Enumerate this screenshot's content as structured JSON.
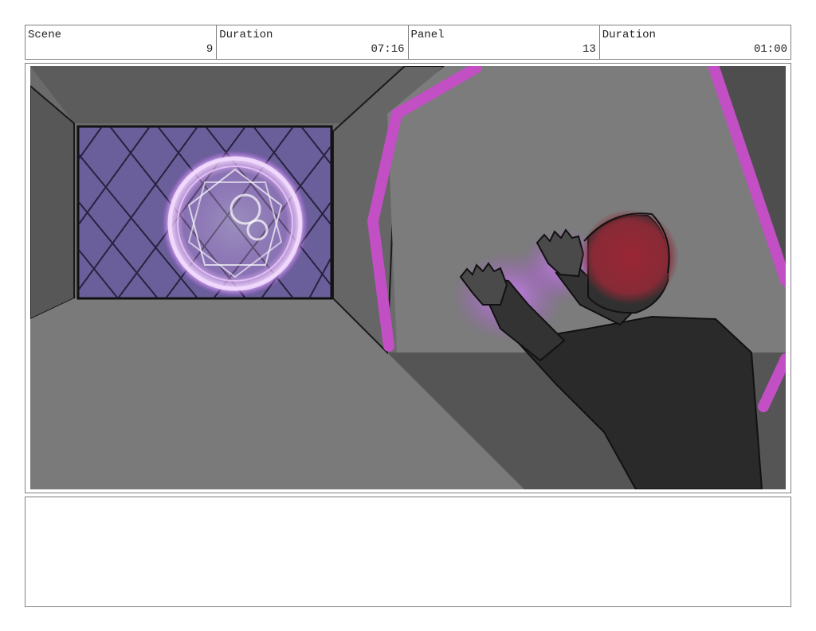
{
  "header": {
    "scene_label": "Scene",
    "scene_value": "9",
    "scene_duration_label": "Duration",
    "scene_duration_value": "07:16",
    "panel_label": "Panel",
    "panel_value": "13",
    "panel_duration_label": "Duration",
    "panel_duration_value": "01:00"
  },
  "colors": {
    "magenta_trim": "#c24fc4",
    "window_purple": "#6a5f9a",
    "glow": "#e6a8ff",
    "hair": "#8c2a36",
    "shirt": "#2a2a2a"
  },
  "notes": {
    "text": ""
  }
}
